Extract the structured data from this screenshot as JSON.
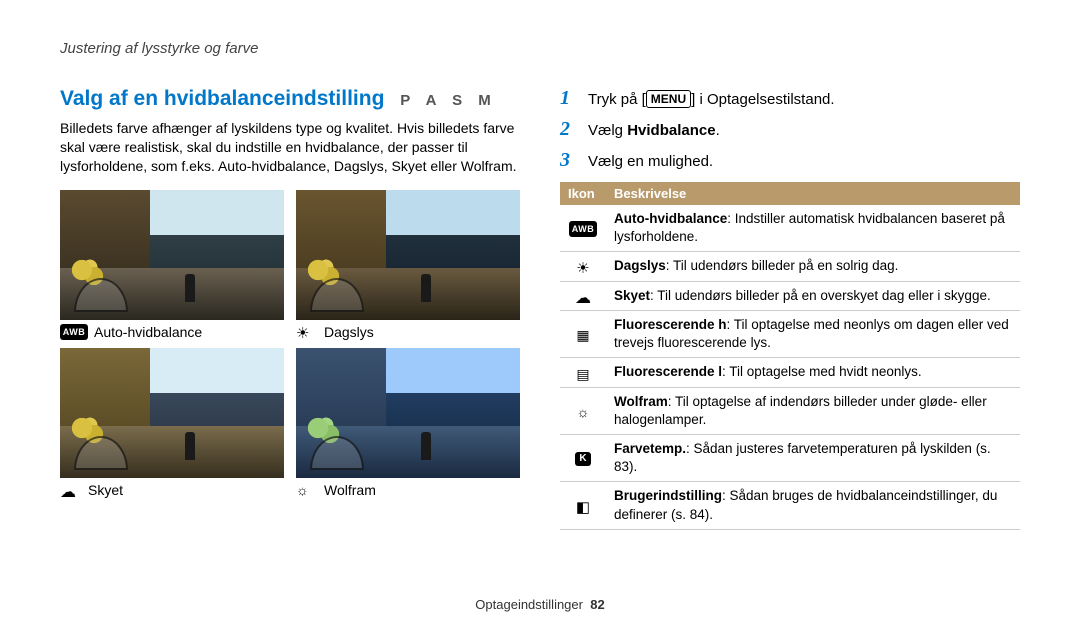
{
  "breadcrumb": "Justering af lysstyrke og farve",
  "left": {
    "heading": "Valg af en hvidbalanceindstilling",
    "modes": "P A S M",
    "intro": "Billedets farve afhænger af lyskildens type og kvalitet. Hvis billedets farve skal være realistisk, skal du indstille en hvidbalance, der passer til lysforholdene, som f.eks. Auto-hvidbalance, Dagslys, Skyet eller Wolfram.",
    "thumbs": {
      "awb": "Auto-hvidbalance",
      "day": "Dagslys",
      "cloud": "Skyet",
      "tungsten": "Wolfram"
    }
  },
  "right": {
    "steps": {
      "s1a": "Tryk på [",
      "s1_key": "MENU",
      "s1b": "] i Optagelsestilstand.",
      "s2a": "Vælg ",
      "s2b": "Hvidbalance",
      "s2c": ".",
      "s3": "Vælg en mulighed."
    },
    "table": {
      "h1": "Ikon",
      "h2": "Beskrivelse",
      "rows": {
        "awb": {
          "b": "Auto-hvidbalance",
          "t": ": Indstiller automatisk hvidbalancen baseret på lysforholdene."
        },
        "day": {
          "b": "Dagslys",
          "t": ": Til udendørs billeder på en solrig dag."
        },
        "cloud": {
          "b": "Skyet",
          "t": ": Til udendørs billeder på en overskyet dag eller i skygge."
        },
        "fluoH": {
          "b": "Fluorescerende h",
          "t": ": Til optagelse med neonlys om dagen eller ved trevejs fluorescerende lys."
        },
        "fluoL": {
          "b": "Fluorescerende l",
          "t": ": Til optagelse med hvidt neonlys."
        },
        "tung": {
          "b": "Wolfram",
          "t": ": Til optagelse af indendørs billeder under gløde- eller halogenlamper."
        },
        "k": {
          "b": "Farvetemp.",
          "t": ": Sådan justeres farvetemperaturen på lyskilden (s. 83)."
        },
        "cust": {
          "b": "Brugerindstilling",
          "t": ": Sådan bruges de hvidbalanceindstillinger, du definerer (s. 84)."
        }
      }
    }
  },
  "footer": {
    "section": "Optageindstillinger",
    "page": "82"
  }
}
